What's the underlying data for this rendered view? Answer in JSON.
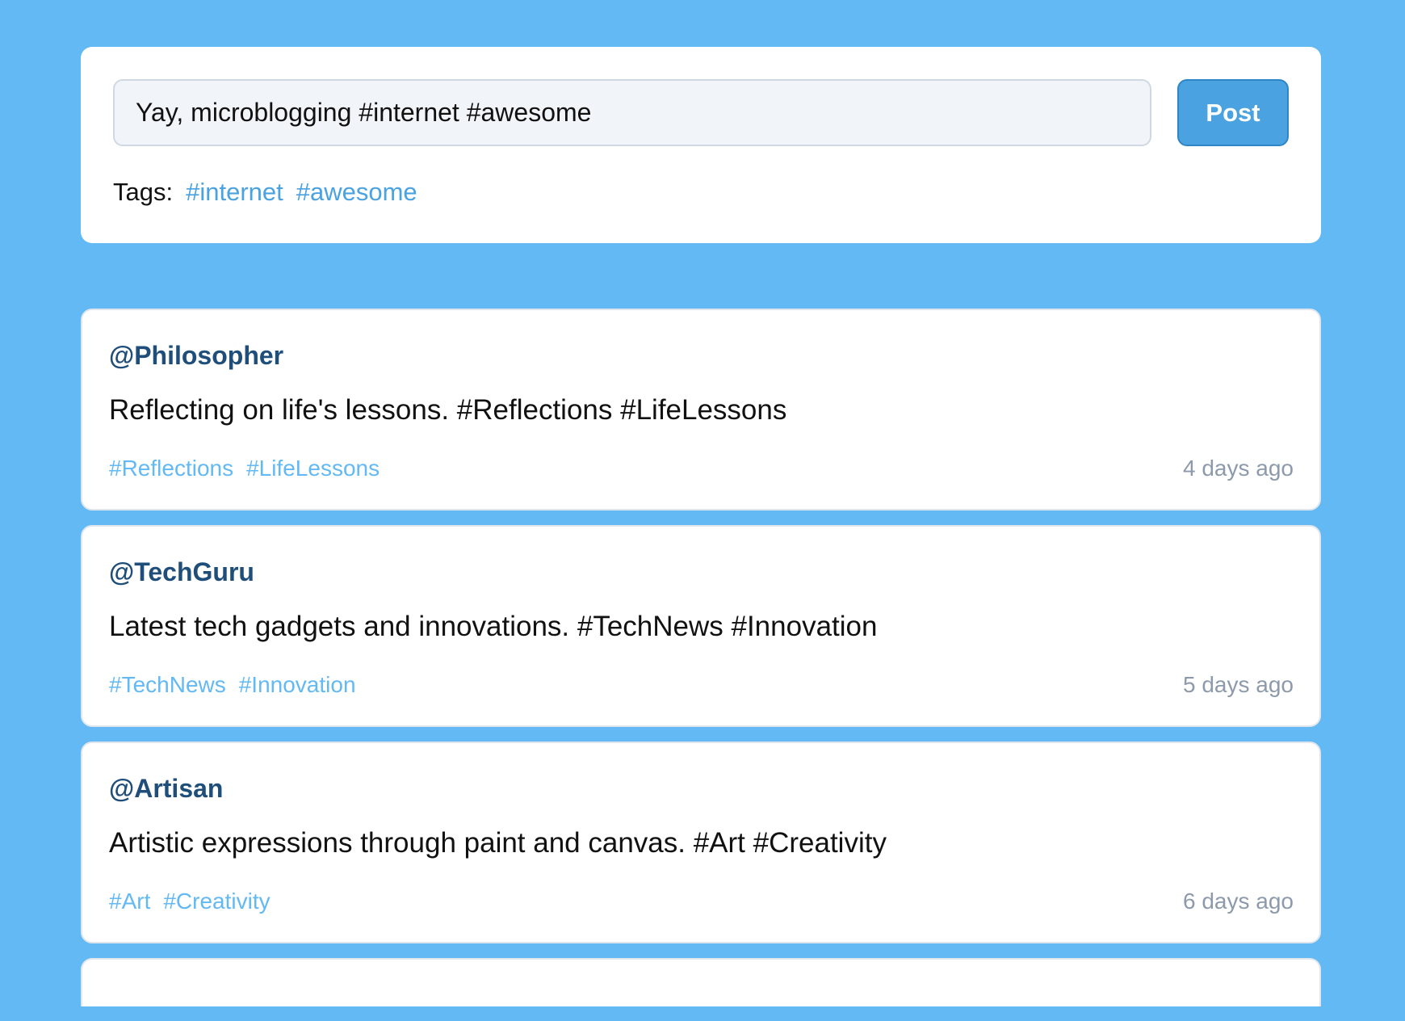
{
  "composer": {
    "input_value": "Yay, microblogging #internet #awesome",
    "post_label": "Post",
    "tags_label": "Tags:",
    "tags": [
      "#internet",
      "#awesome"
    ]
  },
  "posts": [
    {
      "author": "@Philosopher",
      "text": "Reflecting on life's lessons. #Reflections #LifeLessons",
      "tags": [
        "#Reflections",
        "#LifeLessons"
      ],
      "time": "4 days ago"
    },
    {
      "author": "@TechGuru",
      "text": "Latest tech gadgets and innovations. #TechNews #Innovation",
      "tags": [
        "#TechNews",
        "#Innovation"
      ],
      "time": "5 days ago"
    },
    {
      "author": "@Artisan",
      "text": "Artistic expressions through paint and canvas. #Art #Creativity",
      "tags": [
        "#Art",
        "#Creativity"
      ],
      "time": "6 days ago"
    }
  ],
  "colors": {
    "background": "#63b9f3",
    "accent": "#4aa2e0",
    "author": "#1e4e79",
    "tag": "#63b9f3",
    "timestamp": "#8d9aab"
  }
}
